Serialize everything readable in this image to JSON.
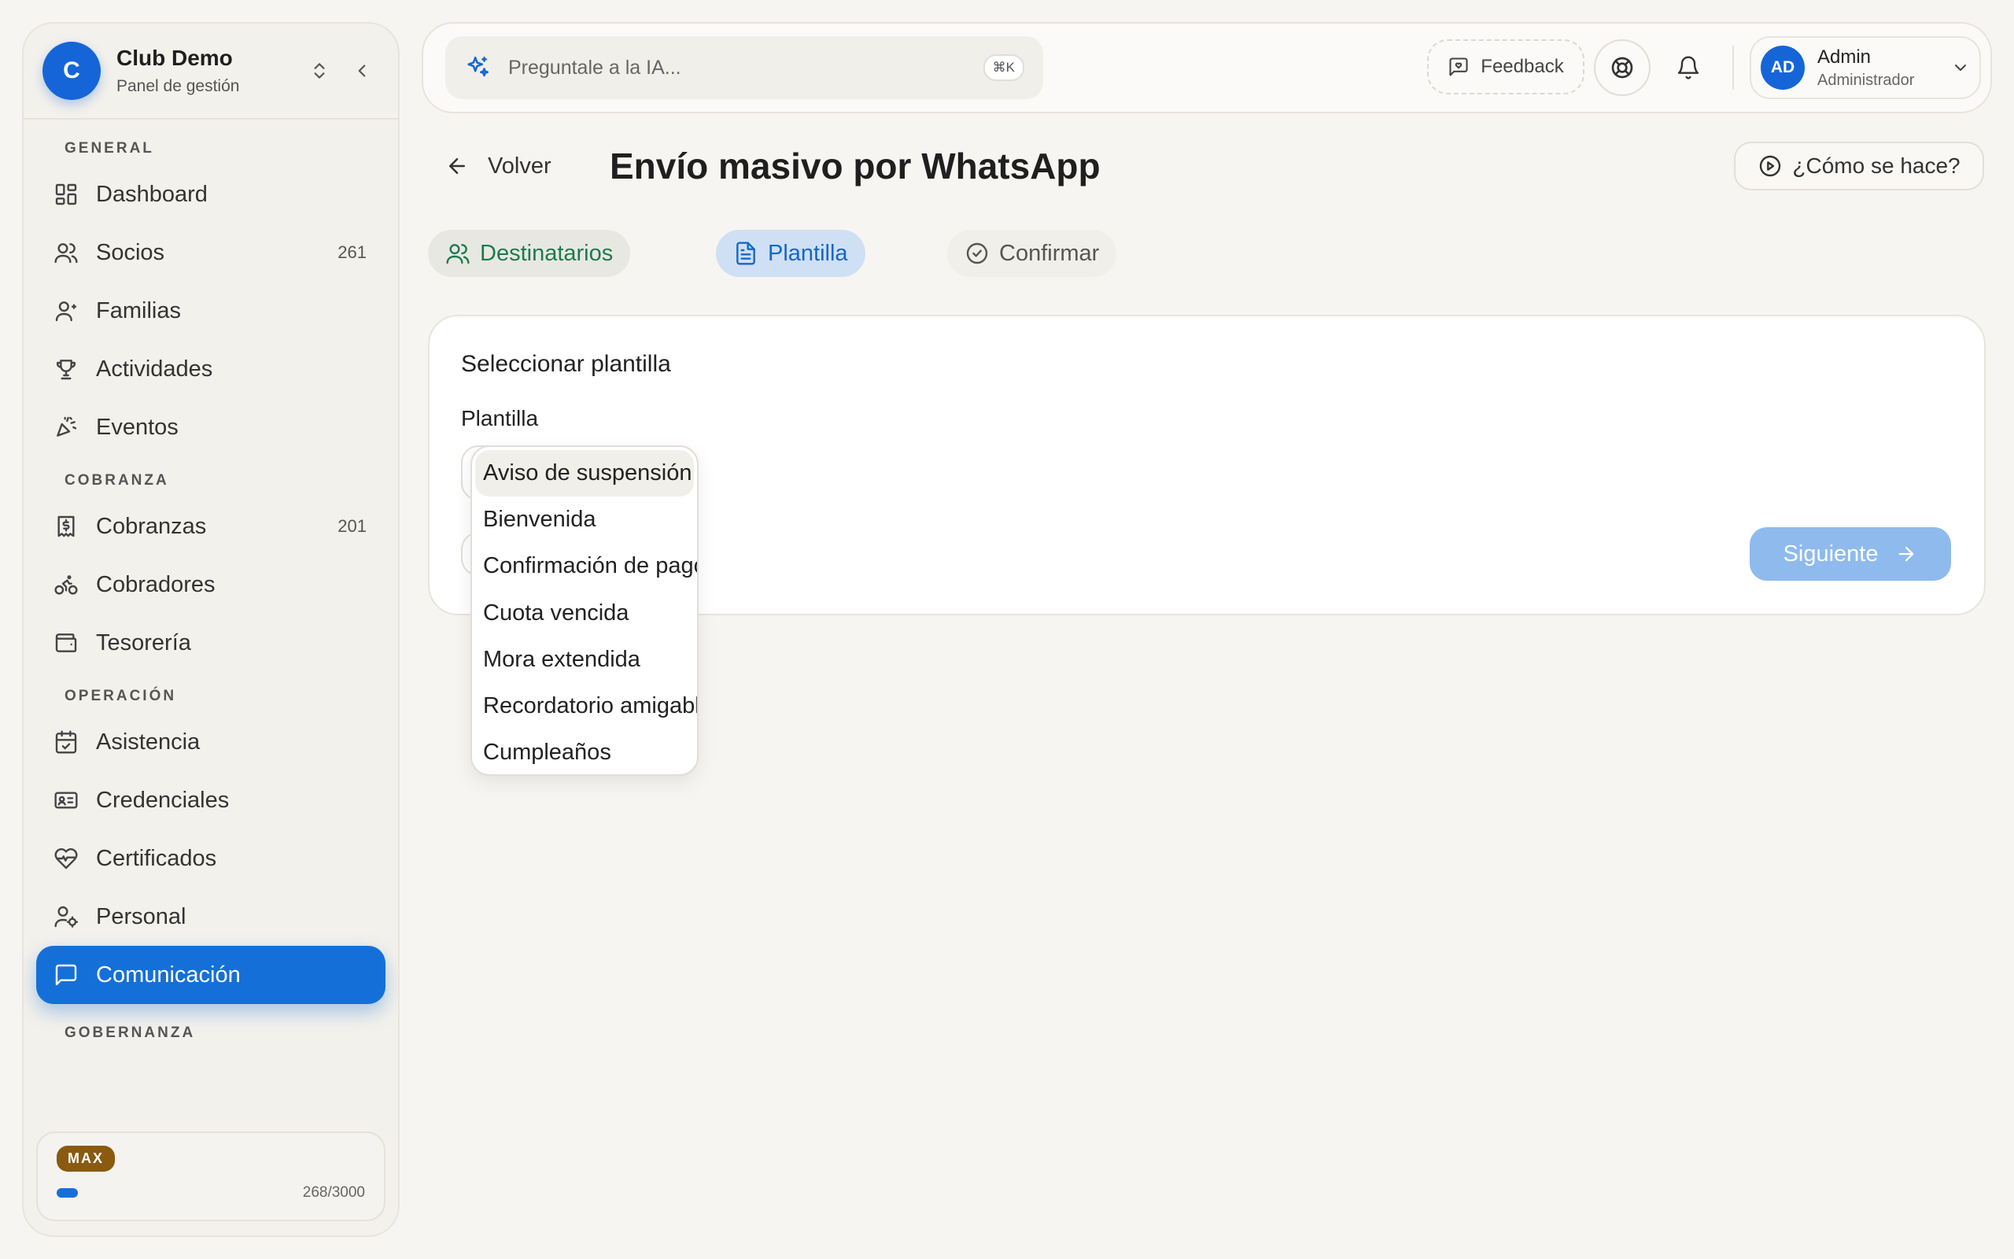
{
  "sidebar": {
    "brand_initial": "C",
    "brand_name": "Club Demo",
    "brand_sub": "Panel de gestión",
    "sections": {
      "general": "GENERAL",
      "cobranza": "COBRANZA",
      "operacion": "OPERACIÓN",
      "gobernanza": "GOBERNANZA"
    },
    "items": {
      "dashboard": "Dashboard",
      "socios": "Socios",
      "socios_count": "261",
      "familias": "Familias",
      "actividades": "Actividades",
      "eventos": "Eventos",
      "cobranzas": "Cobranzas",
      "cobranzas_count": "201",
      "cobradores": "Cobradores",
      "tesoreria": "Tesorería",
      "asistencia": "Asistencia",
      "credenciales": "Credenciales",
      "certificados": "Certificados",
      "personal": "Personal",
      "comunicacion": "Comunicación"
    },
    "plan": {
      "badge": "MAX",
      "usage": "268/3000",
      "used": 268,
      "limit": 3000
    }
  },
  "topbar": {
    "ai_placeholder": "Preguntale a la IA...",
    "shortcut": "⌘K",
    "feedback": "Feedback",
    "user_initials": "AD",
    "user_name": "Admin",
    "user_role": "Administrador"
  },
  "page": {
    "back": "Volver",
    "title": "Envío masivo por WhatsApp",
    "howto": "¿Cómo se hace?"
  },
  "steps": {
    "recipients": "Destinatarios",
    "template": "Plantilla",
    "confirm": "Confirmar"
  },
  "card": {
    "title": "Seleccionar plantilla",
    "field_label": "Plantilla",
    "next": "Siguiente"
  },
  "dropdown": {
    "options": [
      "Aviso de suspensión",
      "Bienvenida",
      "Confirmación de pago",
      "Cuota vencida",
      "Mora extendida",
      "Recordatorio amigable",
      "Cumpleaños"
    ]
  },
  "colors": {
    "primary": "#1470d8",
    "step_recipients": "#1e7a4a",
    "step_template": "#1566c8",
    "plan_badge": "#8a5a10",
    "next_disabled": "#8ebaee"
  }
}
